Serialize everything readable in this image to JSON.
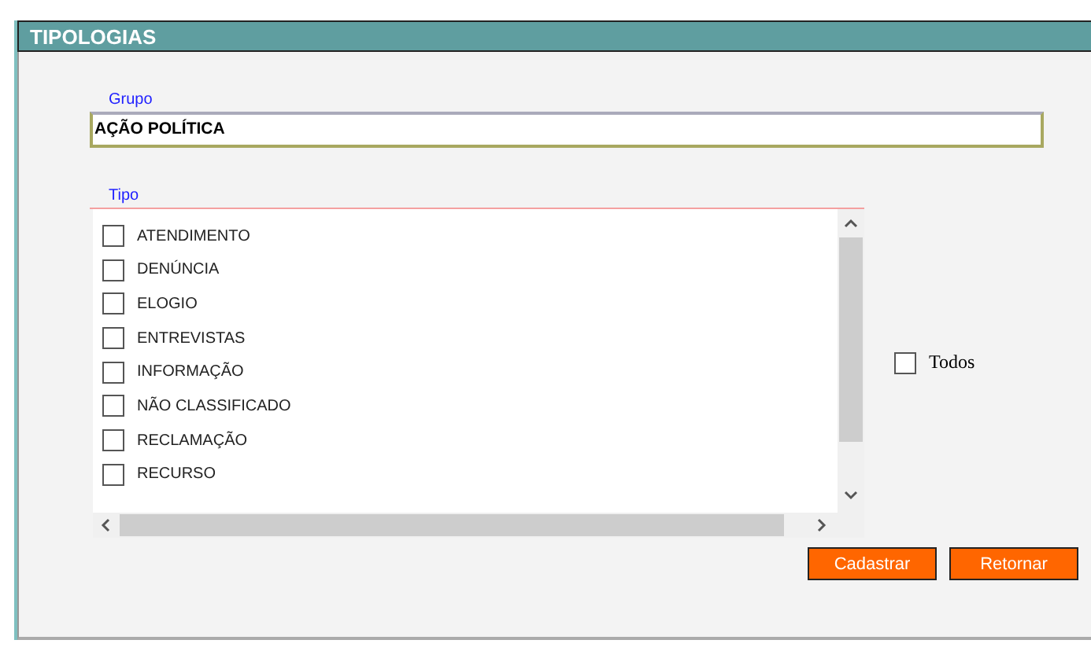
{
  "panel": {
    "title": "TIPOLOGIAS"
  },
  "grupo": {
    "label": "Grupo",
    "value": "AÇÃO POLÍTICA"
  },
  "tipo": {
    "label": "Tipo",
    "items": [
      {
        "label": "ATENDIMENTO",
        "checked": false
      },
      {
        "label": "DENÚNCIA",
        "checked": false
      },
      {
        "label": "ELOGIO",
        "checked": false
      },
      {
        "label": "ENTREVISTAS",
        "checked": false
      },
      {
        "label": "INFORMAÇÃO",
        "checked": false
      },
      {
        "label": "NÃO CLASSIFICADO",
        "checked": false
      },
      {
        "label": "RECLAMAÇÃO",
        "checked": false
      },
      {
        "label": "RECURSO",
        "checked": false
      }
    ]
  },
  "todos": {
    "label": "Todos",
    "checked": false
  },
  "buttons": [
    "Cadastrar",
    "Retornar"
  ]
}
